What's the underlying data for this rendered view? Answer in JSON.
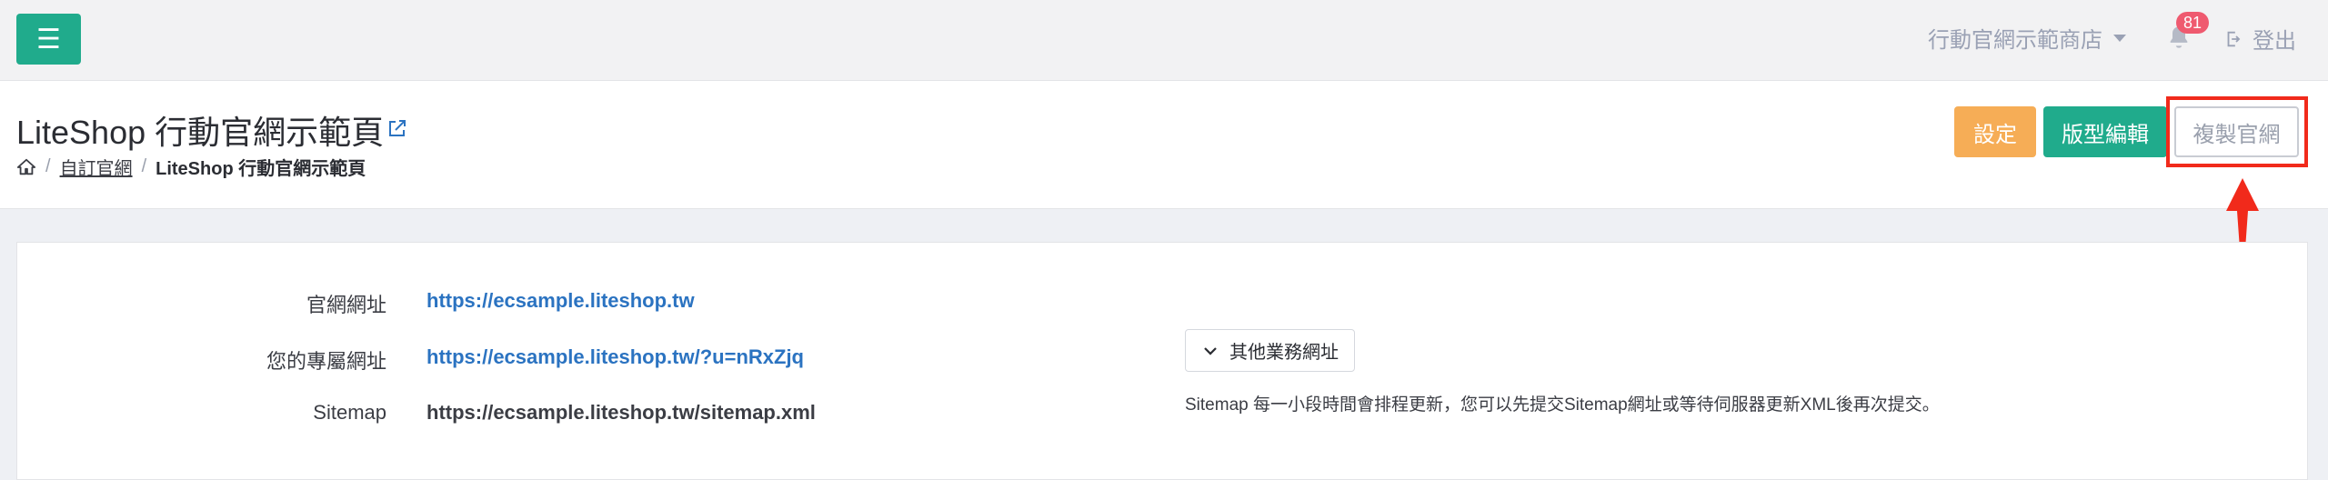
{
  "topbar": {
    "store_name": "行動官網示範商店",
    "notification_count": "81",
    "logout_label": "登出"
  },
  "header": {
    "title": "LiteShop 行動官網示範頁",
    "breadcrumb": {
      "parent": "自訂官網",
      "current": "LiteShop 行動官網示範頁"
    },
    "buttons": {
      "settings": "設定",
      "layout_editor": "版型編輯",
      "copy_site": "複製官網"
    }
  },
  "info": {
    "rows": [
      {
        "label": "官網網址",
        "value": "https://ecsample.liteshop.tw"
      },
      {
        "label": "您的專屬網址",
        "value": "https://ecsample.liteshop.tw/?u=nRxZjq"
      },
      {
        "label": "Sitemap",
        "value": "https://ecsample.liteshop.tw/sitemap.xml"
      }
    ],
    "other_urls_label": "其他業務網址",
    "sitemap_note": "Sitemap 每一小段時間會排程更新，您可以先提交Sitemap網址或等待伺服器更新XML後再次提交。"
  },
  "colors": {
    "primary": "#20ab8c",
    "warning": "#f6ad56",
    "highlight": "#f12a1b",
    "link": "#2b73c1"
  }
}
